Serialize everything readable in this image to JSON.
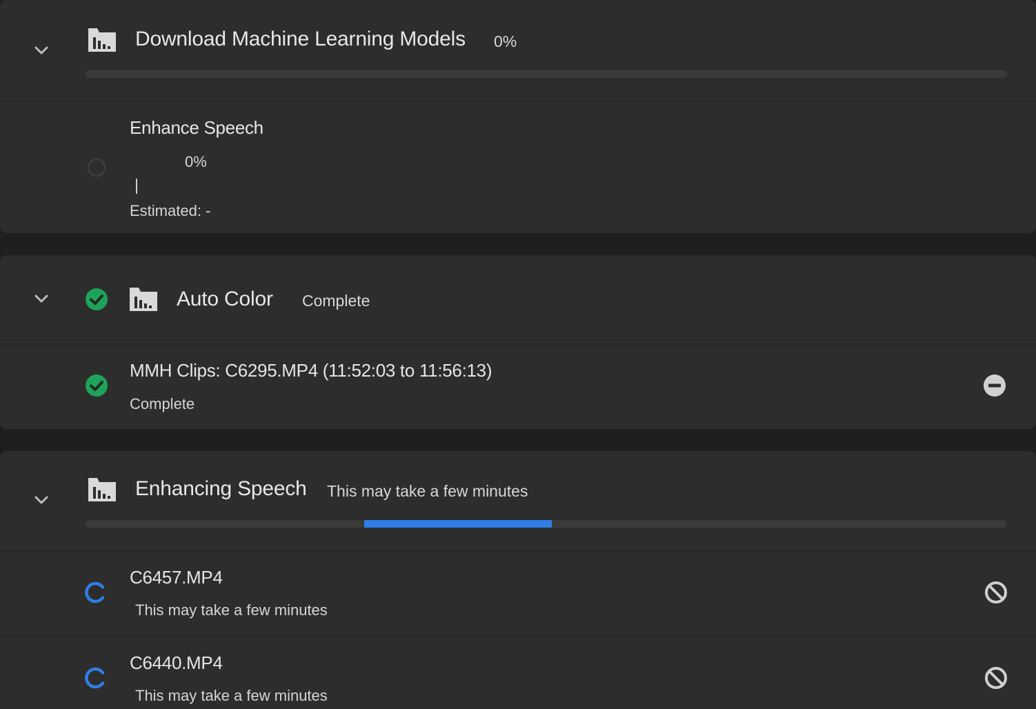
{
  "colors": {
    "background": "#1f1f1f",
    "panel": "#2d2d2d",
    "accent_blue": "#2f7ee6",
    "success_green": "#1fa35a",
    "track": "#3a3a3a"
  },
  "sections": [
    {
      "title": "Download Machine Learning Models",
      "status": "0%",
      "icon": "folder-chart-icon",
      "progress": 0,
      "items": [
        {
          "title": "Enhance Speech",
          "percent": "0%",
          "estimated": "Estimated: -",
          "status_icon": "pending-circle-icon"
        }
      ]
    },
    {
      "title": "Auto Color",
      "status": "Complete",
      "icon": "folder-chart-icon",
      "status_icon": "check-circle-icon",
      "items": [
        {
          "title": "MMH Clips: C6295.MP4 (11:52:03 to 11:56:13)",
          "subtitle": "Complete",
          "status_icon": "check-circle-icon",
          "action_icon": "remove-circle-icon"
        }
      ]
    },
    {
      "title": "Enhancing Speech",
      "status": "This may take a few minutes",
      "icon": "folder-chart-icon",
      "progress": "indeterminate",
      "items": [
        {
          "title": "C6457.MP4",
          "subtitle": "This may take a few minutes",
          "status_icon": "spinner-icon",
          "action_icon": "cancel-icon"
        },
        {
          "title": "C6440.MP4",
          "subtitle": "This may take a few minutes",
          "status_icon": "spinner-icon",
          "action_icon": "cancel-icon"
        }
      ]
    }
  ]
}
